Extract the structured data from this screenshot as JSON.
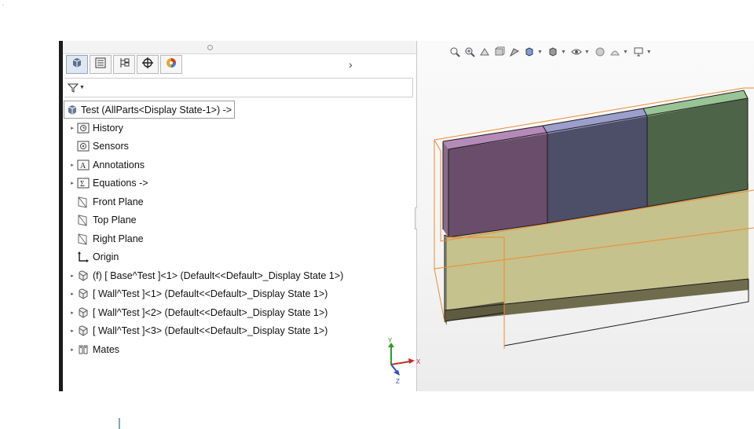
{
  "feature_manager": {
    "tabs": [
      {
        "icon": "feature-tree-icon"
      },
      {
        "icon": "property-manager-icon"
      },
      {
        "icon": "configuration-manager-icon"
      },
      {
        "icon": "dimxpert-icon"
      },
      {
        "icon": "display-manager-icon"
      }
    ],
    "filter_icon": "filter-icon",
    "root_label": "Test  (AllParts<Display State-1>) ->",
    "items": [
      {
        "label": "History",
        "icon": "history-icon",
        "expandable": true
      },
      {
        "label": "Sensors",
        "icon": "sensors-icon",
        "expandable": false
      },
      {
        "label": "Annotations",
        "icon": "annotations-icon",
        "expandable": true
      },
      {
        "label": "Equations ->",
        "icon": "equations-icon",
        "expandable": true
      },
      {
        "label": "Front Plane",
        "icon": "plane-icon",
        "expandable": false
      },
      {
        "label": "Top Plane",
        "icon": "plane-icon",
        "expandable": false
      },
      {
        "label": "Right Plane",
        "icon": "plane-icon",
        "expandable": false
      },
      {
        "label": "Origin",
        "icon": "origin-icon",
        "expandable": false
      },
      {
        "label": "(f) [ Base^Test ]<1> (Default<<Default>_Display State 1>)",
        "icon": "part-icon",
        "expandable": true
      },
      {
        "label": "[ Wall^Test ]<1> (Default<<Default>_Display State 1>)",
        "icon": "part-icon",
        "expandable": true
      },
      {
        "label": "[ Wall^Test ]<2> (Default<<Default>_Display State 1>)",
        "icon": "part-icon",
        "expandable": true
      },
      {
        "label": "[ Wall^Test ]<3> (Default<<Default>_Display State 1>)",
        "icon": "part-icon",
        "expandable": true
      },
      {
        "label": "Mates",
        "icon": "mates-icon",
        "expandable": true
      }
    ]
  },
  "heads_up_toolbar": {
    "buttons": [
      "zoom-to-fit-icon",
      "zoom-to-area-icon",
      "previous-view-icon",
      "section-view-icon",
      "dynamic-annotation-icon",
      "view-orientation-icon",
      "display-style-icon",
      "hide-show-icon",
      "edit-appearance-icon",
      "apply-scene-icon",
      "view-settings-icon"
    ]
  },
  "triad": {
    "x_label": "X",
    "y_label": "Y",
    "z_label": "Z"
  },
  "model": {
    "colors": {
      "base_top": "#c5c28e",
      "base_front": "#6f6c4e",
      "base_side": "#8a8763",
      "wall1_front": "#6a4d6a",
      "wall1_top": "#b58ab8",
      "wall2_front": "#4d4e68",
      "wall2_top": "#9c9fcc",
      "wall3_front": "#4d6449",
      "wall3_top": "#99c494",
      "bbox": "#f08a2e"
    }
  }
}
